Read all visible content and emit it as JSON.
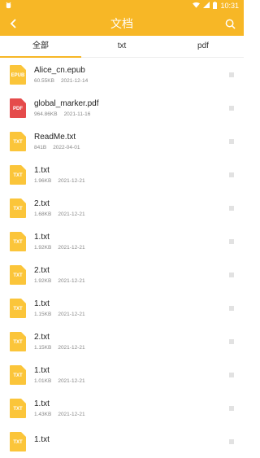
{
  "status_bar": {
    "left_icon": "bug-icon",
    "time": "10:31"
  },
  "app_bar": {
    "title": "文档"
  },
  "tabs": [
    {
      "label": "全部",
      "active": true
    },
    {
      "label": "txt",
      "active": false
    },
    {
      "label": "pdf",
      "active": false
    }
  ],
  "colors": {
    "accent": "#f7b726",
    "file_yellow": "#fbc53a",
    "file_red": "#e54b4b"
  },
  "files": [
    {
      "name": "Alice_cn.epub",
      "size": "60.55KB",
      "date": "2021-12-14",
      "icon": "EPUB",
      "color": "yellow"
    },
    {
      "name": "global_marker.pdf",
      "size": "964.86KB",
      "date": "2021-11-16",
      "icon": "PDF",
      "color": "red"
    },
    {
      "name": "ReadMe.txt",
      "size": "841B",
      "date": "2022-04-01",
      "icon": "TXT",
      "color": "yellow"
    },
    {
      "name": "1.txt",
      "size": "1.96KB",
      "date": "2021-12-21",
      "icon": "TXT",
      "color": "yellow"
    },
    {
      "name": "2.txt",
      "size": "1.68KB",
      "date": "2021-12-21",
      "icon": "TXT",
      "color": "yellow"
    },
    {
      "name": "1.txt",
      "size": "1.92KB",
      "date": "2021-12-21",
      "icon": "TXT",
      "color": "yellow"
    },
    {
      "name": "2.txt",
      "size": "1.92KB",
      "date": "2021-12-21",
      "icon": "TXT",
      "color": "yellow"
    },
    {
      "name": "1.txt",
      "size": "1.15KB",
      "date": "2021-12-21",
      "icon": "TXT",
      "color": "yellow"
    },
    {
      "name": "2.txt",
      "size": "1.15KB",
      "date": "2021-12-21",
      "icon": "TXT",
      "color": "yellow"
    },
    {
      "name": "1.txt",
      "size": "1.01KB",
      "date": "2021-12-21",
      "icon": "TXT",
      "color": "yellow"
    },
    {
      "name": "1.txt",
      "size": "1.43KB",
      "date": "2021-12-21",
      "icon": "TXT",
      "color": "yellow"
    },
    {
      "name": "1.txt",
      "size": "",
      "date": "",
      "icon": "TXT",
      "color": "yellow"
    }
  ]
}
